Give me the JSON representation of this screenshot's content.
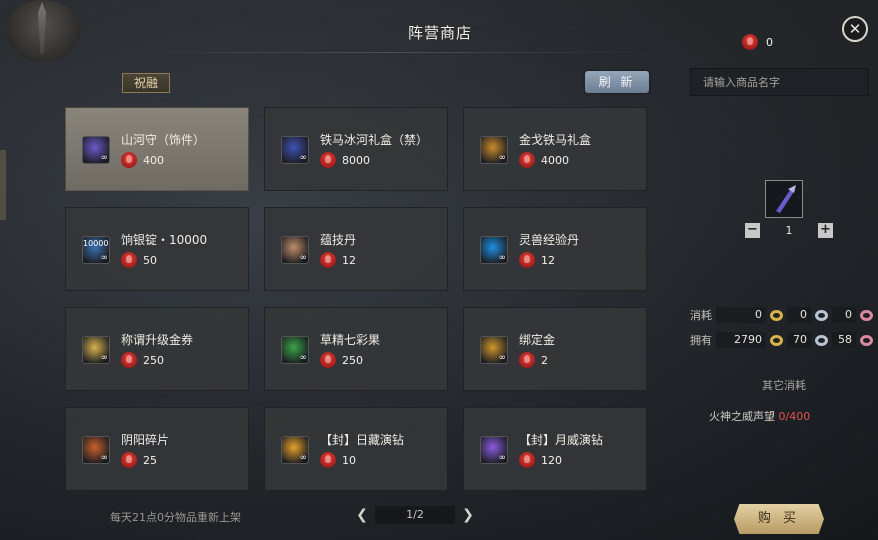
{
  "header": {
    "title": "阵营商店",
    "currency_value": "0"
  },
  "tabs": {
    "blessing": "祝融"
  },
  "refresh_label": "刷 新",
  "search": {
    "placeholder": "请输入商品名字"
  },
  "items": [
    {
      "name": "山河守（饰件）",
      "price": "400",
      "icon": "hammer-icon",
      "color": "#6a5acd"
    },
    {
      "name": "铁马冰河礼盒（禁）",
      "price": "8000",
      "icon": "horse-giftbox-icon",
      "color": "#3f51b5"
    },
    {
      "name": "金戈铁马礼盒",
      "price": "4000",
      "icon": "gold-giftbox-icon",
      "color": "#c88a2a"
    },
    {
      "name": "饷银锭・10000",
      "price": "50",
      "icon": "silver-ingot-icon",
      "color": "#3a6fb0",
      "badge": "10000"
    },
    {
      "name": "蕴技丹",
      "price": "12",
      "icon": "pill-icon",
      "color": "#c08d6a"
    },
    {
      "name": "灵兽经验丹",
      "price": "12",
      "icon": "blue-orb-icon",
      "color": "#1e8fe0"
    },
    {
      "name": "称谓升级金券",
      "price": "250",
      "icon": "gold-ticket-icon",
      "color": "#d8b24c"
    },
    {
      "name": "草精七彩果",
      "price": "250",
      "icon": "green-fruit-icon",
      "color": "#3aa34a"
    },
    {
      "name": "绑定金",
      "price": "2",
      "icon": "gold-ingot-icon",
      "color": "#d0962a"
    },
    {
      "name": "阴阳碎片",
      "price": "25",
      "icon": "shard-icon",
      "color": "#c8602a"
    },
    {
      "name": "【封】日藏演钻",
      "price": "10",
      "icon": "sun-gem-icon",
      "color": "#e8a028"
    },
    {
      "name": "【封】月威演钻",
      "price": "120",
      "icon": "moon-gem-icon",
      "color": "#8a5ae0"
    }
  ],
  "footer": {
    "note": "每天21点0分物品重新上架",
    "page": "1/2"
  },
  "purchase": {
    "quantity": "1",
    "cost_label": "消耗",
    "owned_label": "拥有",
    "cost": [
      "0",
      "0",
      "0"
    ],
    "owned": [
      "2790",
      "70",
      "58"
    ],
    "other_cost_label": "其它消耗",
    "fame_label": "火神之威声望",
    "fame_value": "0/400",
    "buy_label": "购 买"
  }
}
